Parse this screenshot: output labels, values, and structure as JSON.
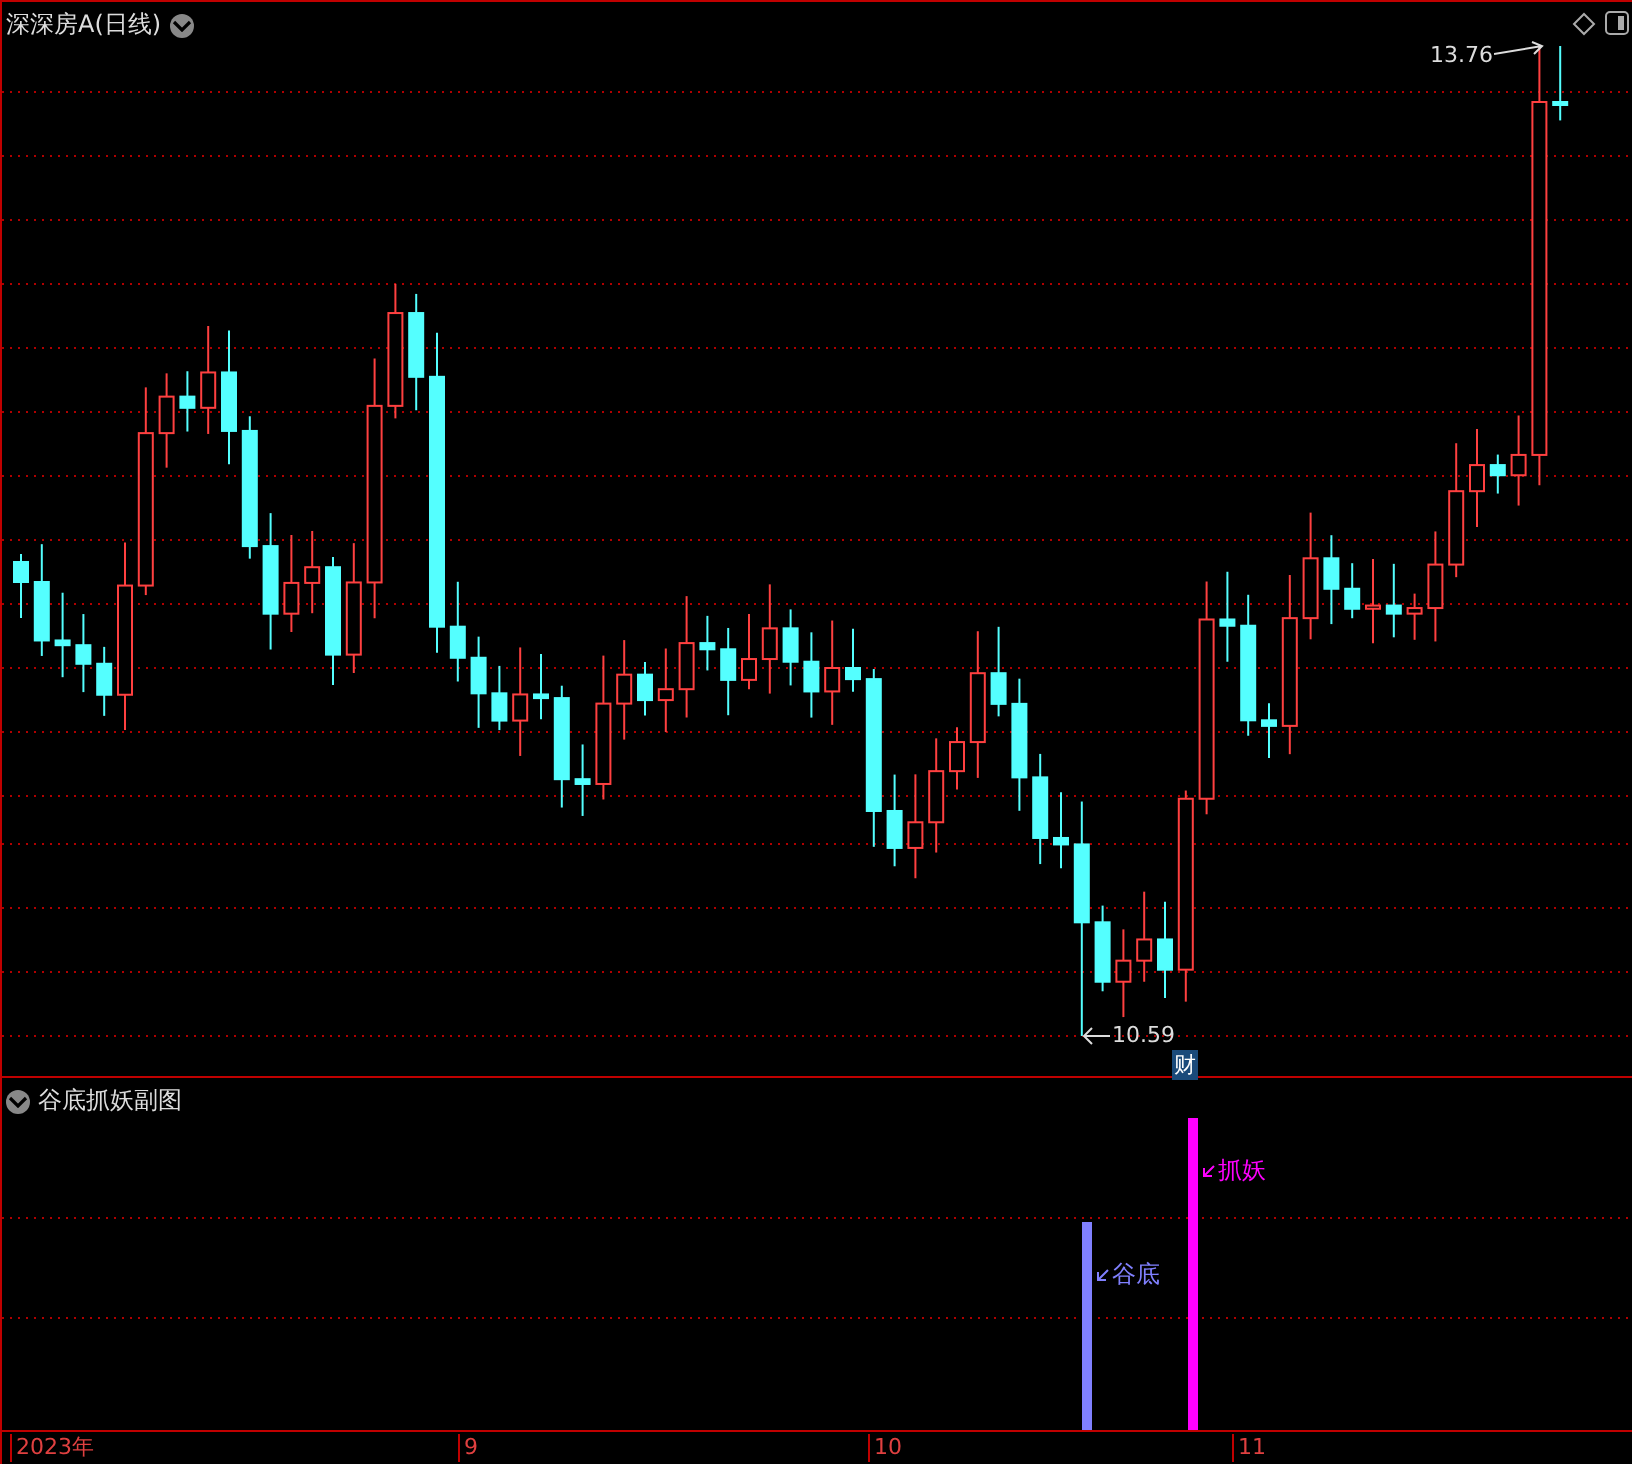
{
  "main_panel": {
    "title": "深深房A(日线)",
    "high_label": "13.76",
    "low_label": "10.59",
    "event_badge": "财"
  },
  "sub_panel": {
    "title": "谷底抓妖副图",
    "signals": [
      {
        "label": "谷底",
        "color": "#8080ff"
      },
      {
        "label": "抓妖",
        "color": "#ff00ff"
      }
    ]
  },
  "x_axis": [
    "2023年",
    "9",
    "10",
    "11"
  ]
}
